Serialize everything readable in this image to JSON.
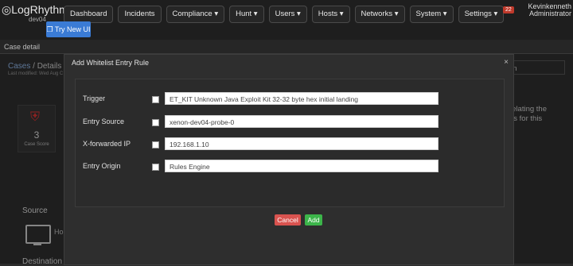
{
  "app": {
    "logo_text": "LogRhythm",
    "env": "dev04"
  },
  "nav": {
    "items": [
      "Dashboard",
      "Incidents",
      "Compliance ▾",
      "Hunt ▾",
      "Users ▾",
      "Hosts ▾",
      "Networks ▾",
      "System ▾",
      "Settings ▾"
    ],
    "try_new_ui": "Try New UI"
  },
  "user": {
    "notification_count": "22",
    "name": "Kevinkenneth",
    "role": "Administrator"
  },
  "page": {
    "subtitle": "Case detail",
    "breadcrumb_root": "Cases",
    "breadcrumb_current": "Details",
    "last_modified": "Last modified: Wed Aug C",
    "right_select": "tion",
    "right_text": [
      "relating the",
      "as for this"
    ],
    "case_score_value": "3",
    "case_score_label": "Case Score",
    "source_label": "Source",
    "source_host": "Ho",
    "destination_label": "Destination"
  },
  "modal": {
    "title": "Add Whitelist Entry Rule",
    "close": "×",
    "rows": [
      {
        "label": "Trigger",
        "value": "ET_KIT Unknown Java Exploit Kit 32-32 byte hex initial landing"
      },
      {
        "label": "Entry Source",
        "value": "xenon-dev04-probe-0"
      },
      {
        "label": "X-forwarded IP",
        "value": "192.168.1.10"
      },
      {
        "label": "Entry Origin",
        "value": "Rules Engine"
      }
    ],
    "cancel_label": "Cancel",
    "add_label": "Add"
  }
}
